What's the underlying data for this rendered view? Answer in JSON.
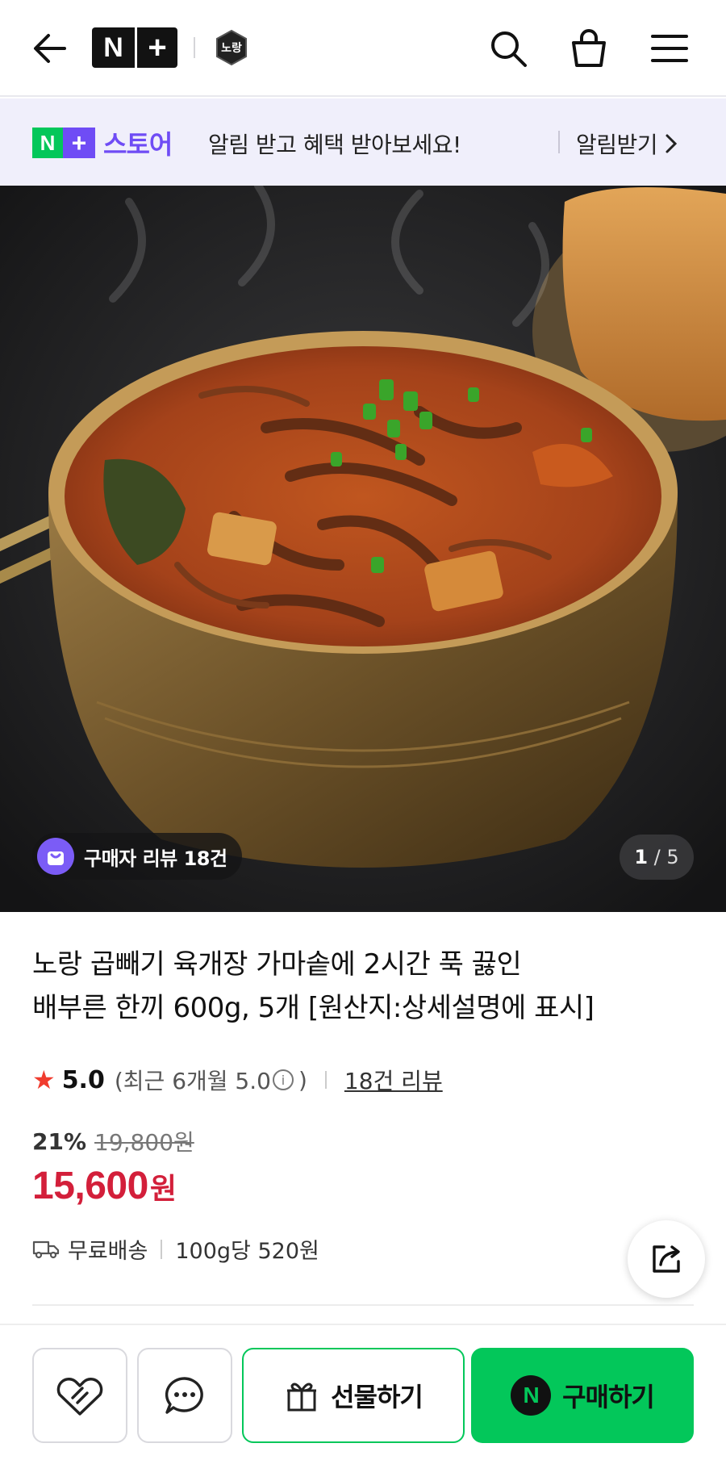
{
  "header": {
    "nplus_n": "N",
    "nplus_plus": "+",
    "brand_logo_text": "노랑",
    "icons": [
      "back-arrow-icon",
      "search-icon",
      "cart-icon",
      "menu-icon"
    ]
  },
  "banner": {
    "logo_n": "N",
    "logo_plus": "+",
    "store_label": "스토어",
    "message": "알림 받고 혜택 받아보세요!",
    "action_label": "알림받기"
  },
  "hero": {
    "review_chip_label": "구매자 리뷰 18건",
    "page_current": "1",
    "page_total": "/ 5"
  },
  "product": {
    "title_line1": "노랑 곱빼기 육개장 가마솥에 2시간 푹 끓인",
    "title_line2": "배부른 한끼 600g, 5개 [원산지:상세설명에 표시]",
    "rating_score": "5.0",
    "rating_recent": "(최근 6개월 5.0",
    "rating_info": "i",
    "rating_recent_close": ")",
    "review_link": "18건 리뷰",
    "discount_percent": "21%",
    "original_price": "19,800원",
    "sale_price": "15,600",
    "sale_price_unit": "원",
    "shipping": "무료배송",
    "unit_price": "100g당 520원"
  },
  "bottom_bar": {
    "gift_label": "선물하기",
    "buy_label": "구매하기",
    "buy_logo": "N"
  },
  "colors": {
    "naver_green": "#03c75a",
    "store_purple": "#6f4cf5",
    "price_red": "#d31f3a",
    "star_red": "#f03c2e",
    "banner_bg": "#f0effb"
  }
}
